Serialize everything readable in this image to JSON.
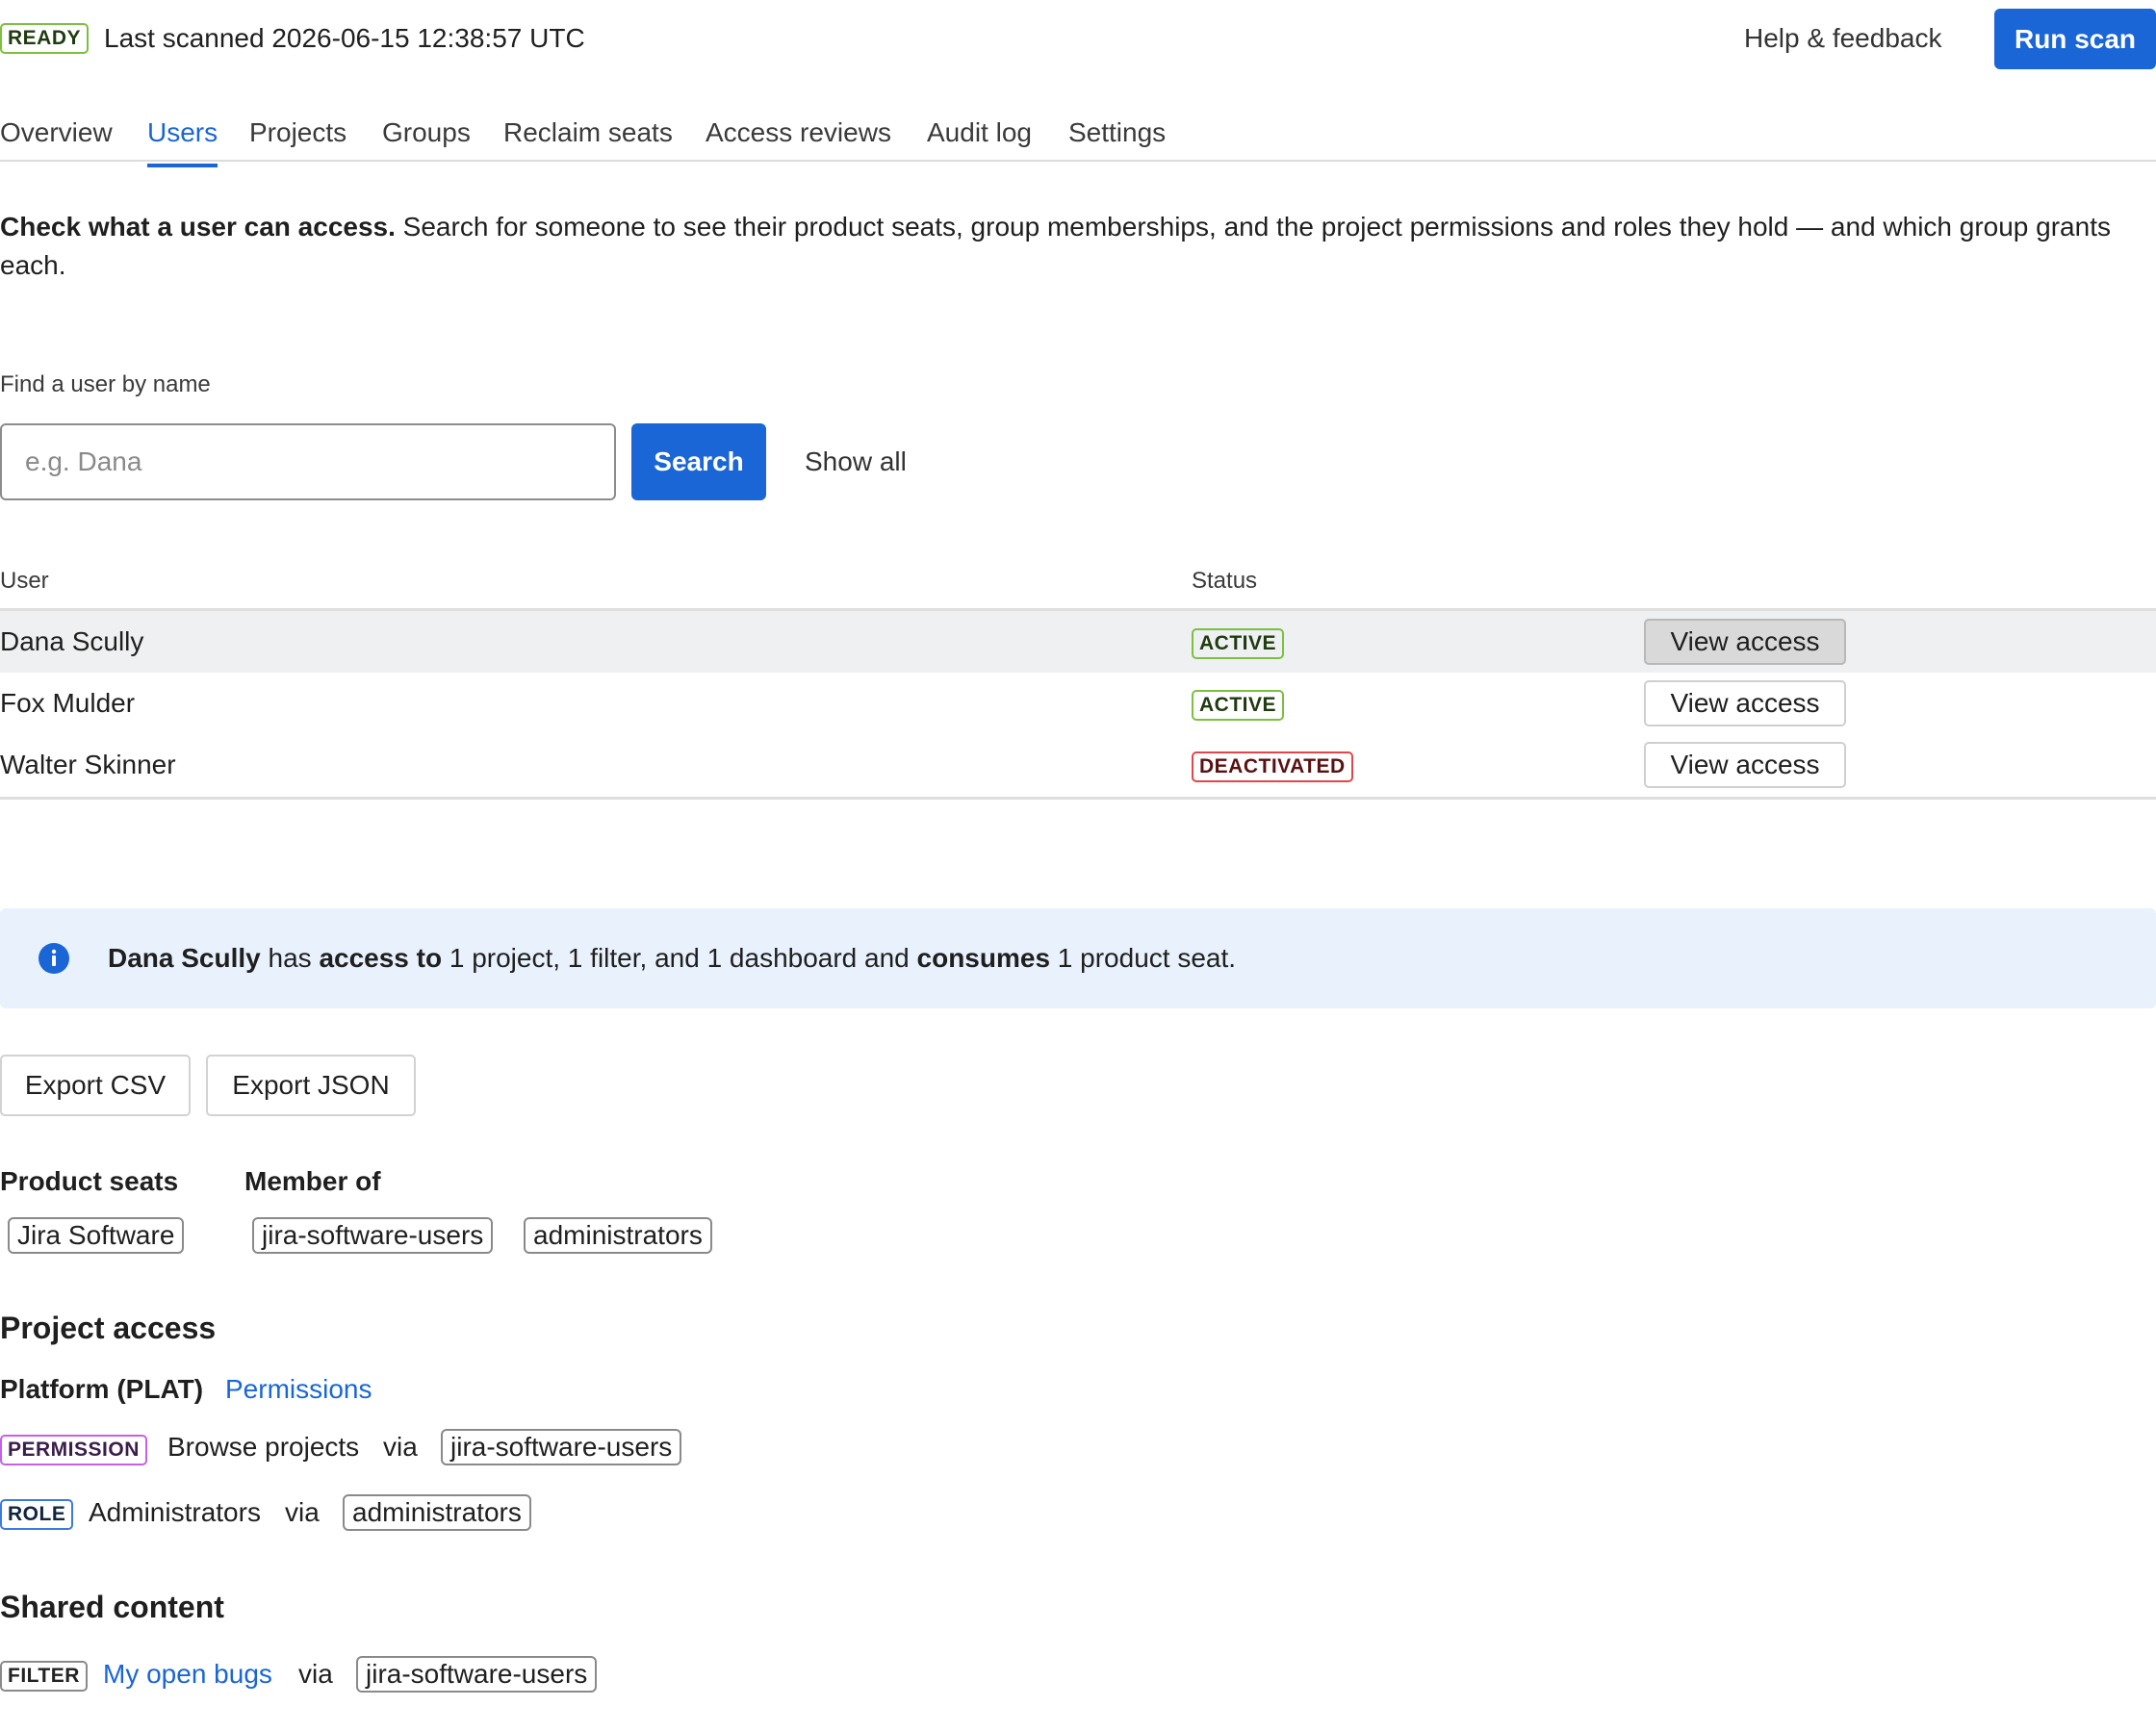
{
  "header": {
    "status_badge": "READY",
    "last_scanned": "Last scanned 2026-06-15 12:38:57 UTC",
    "help_label": "Help & feedback",
    "run_scan_label": "Run scan"
  },
  "tabs": [
    {
      "label": "Overview"
    },
    {
      "label": "Users"
    },
    {
      "label": "Projects"
    },
    {
      "label": "Groups"
    },
    {
      "label": "Reclaim seats"
    },
    {
      "label": "Access reviews"
    },
    {
      "label": "Audit log"
    },
    {
      "label": "Settings"
    }
  ],
  "active_tab": "Users",
  "intro": {
    "bold": "Check what a user can access.",
    "text": " Search for someone to see their product seats, group memberships, and the project permissions and roles they hold — and which group grants each."
  },
  "search": {
    "label": "Find a user by name",
    "placeholder": "e.g. Dana",
    "value": "",
    "button_label": "Search",
    "show_all_label": "Show all"
  },
  "users_table": {
    "columns": [
      "User",
      "Status"
    ],
    "rows": [
      {
        "name": "Dana Scully",
        "status": "ACTIVE",
        "action": "View access",
        "selected": true
      },
      {
        "name": "Fox Mulder",
        "status": "ACTIVE",
        "action": "View access",
        "selected": false
      },
      {
        "name": "Walter Skinner",
        "status": "DEACTIVATED",
        "action": "View access",
        "selected": false
      }
    ]
  },
  "summary": {
    "user": "Dana Scully",
    "t1": " has ",
    "b1": "access to",
    "t2": " 1 project, 1 filter, and 1 dashboard and ",
    "b2": "consumes",
    "t3": " 1 product seat.",
    "icon": "info-icon"
  },
  "export": {
    "csv_label": "Export CSV",
    "json_label": "Export JSON"
  },
  "product_seats": {
    "heading": "Product seats",
    "items": [
      "Jira Software"
    ]
  },
  "member_of": {
    "heading": "Member of",
    "items": [
      "jira-software-users",
      "administrators"
    ]
  },
  "project_access": {
    "heading": "Project access",
    "project_name": "Platform (PLAT)",
    "permissions_link": "Permissions",
    "grants": [
      {
        "type": "PERMISSION",
        "name": "Browse projects",
        "via": "via",
        "group": "jira-software-users"
      },
      {
        "type": "ROLE",
        "name": "Administrators",
        "via": "via",
        "group": "administrators"
      }
    ]
  },
  "shared_content": {
    "heading": "Shared content",
    "items": [
      {
        "type": "FILTER",
        "name": "My open bugs",
        "via": "via",
        "group": "jira-software-users"
      }
    ]
  },
  "colors": {
    "accent": "#1a66d6",
    "active_border": "#7bc041",
    "deactivated_border": "#e0474c",
    "permission_border": "#c561e6",
    "role_border": "#3b7bde",
    "info_bg": "#e9f1fd"
  }
}
